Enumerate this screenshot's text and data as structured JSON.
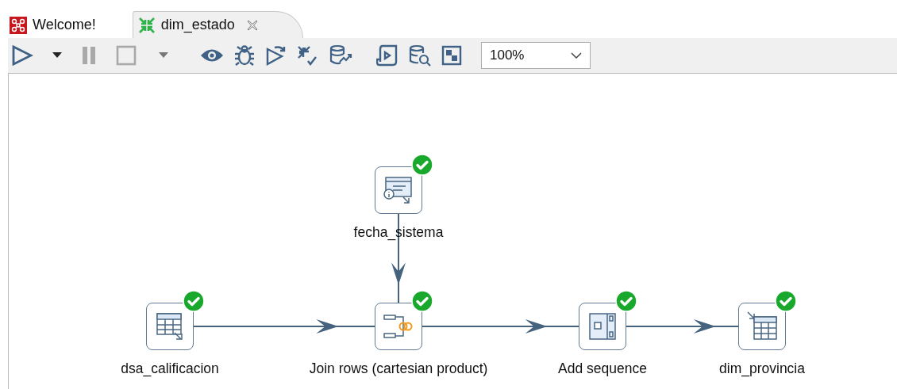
{
  "tabs": [
    {
      "label": "Welcome!",
      "selected": false,
      "kind": "welcome"
    },
    {
      "label": "dim_estado",
      "selected": true,
      "kind": "transformation"
    }
  ],
  "toolbar": {
    "buttons": [
      {
        "kind": "run",
        "disabled": false
      },
      {
        "kind": "caret",
        "disabled": false
      },
      {
        "kind": "pause",
        "disabled": true
      },
      {
        "kind": "stop",
        "disabled": true
      },
      {
        "kind": "caret",
        "disabled": true
      },
      {
        "kind": "preview",
        "disabled": false
      },
      {
        "kind": "debug",
        "disabled": false
      },
      {
        "kind": "replay",
        "disabled": false
      },
      {
        "kind": "verify",
        "disabled": false
      },
      {
        "kind": "impact",
        "disabled": false
      },
      {
        "kind": "sql",
        "disabled": false
      },
      {
        "kind": "explore",
        "disabled": false
      },
      {
        "kind": "grid",
        "disabled": false
      }
    ],
    "zoom": "100%"
  },
  "steps": [
    {
      "label": "fecha_sistema",
      "kind": "system-info",
      "ok": true
    },
    {
      "label": "dsa_calificacion",
      "kind": "table-input",
      "ok": true
    },
    {
      "label": "Join rows (cartesian product)",
      "kind": "join",
      "ok": true
    },
    {
      "label": "Add sequence",
      "kind": "sequence",
      "ok": true
    },
    {
      "label": "dim_provincia",
      "kind": "table-output",
      "ok": true
    }
  ]
}
